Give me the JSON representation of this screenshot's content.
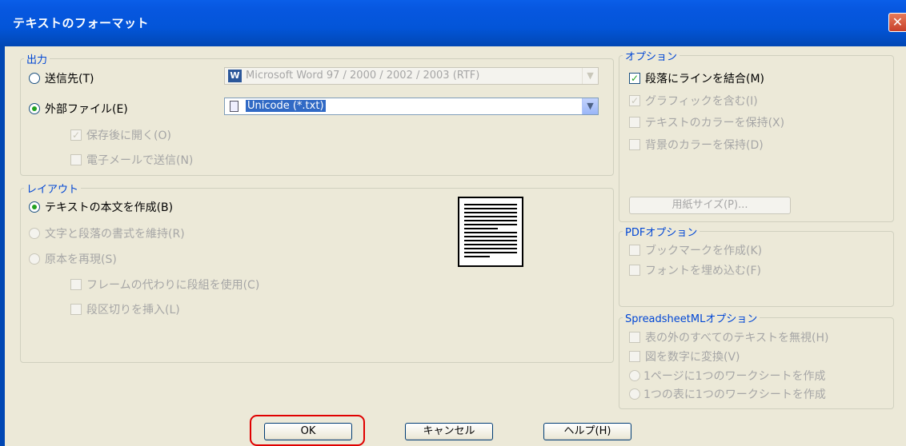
{
  "window": {
    "title": "テキストのフォーマット",
    "close_label": "✕"
  },
  "output": {
    "legend": "出力",
    "send_to_label": "送信先(T)",
    "send_to_value": "Microsoft Word 97 / 2000 / 2002 / 2003 (RTF)",
    "external_file_label": "外部ファイル(E)",
    "external_file_value": "Unicode (*.txt)",
    "open_after_save_label": "保存後に開く(O)",
    "send_mail_label": "電子メールで送信(N)"
  },
  "layout": {
    "legend": "レイアウト",
    "create_body_label": "テキストの本文を作成(B)",
    "keep_format_label": "文字と段落の書式を維持(R)",
    "reproduce_label": "原本を再現(S)",
    "use_columns_label": "フレームの代わりに段組を使用(C)",
    "insert_breaks_label": "段区切りを挿入(L)"
  },
  "options": {
    "legend": "オプション",
    "combine_lines_label": "段落にラインを結合(M)",
    "include_graphics_label": "グラフィックを含む(I)",
    "keep_text_color_label": "テキストのカラーを保持(X)",
    "keep_bg_color_label": "背景のカラーを保持(D)",
    "paper_size_label": "用紙サイズ(P)..."
  },
  "pdf_options": {
    "legend": "PDFオプション",
    "bookmarks_label": "ブックマークを作成(K)",
    "embed_fonts_label": "フォントを埋め込む(F)"
  },
  "spreadsheetml_options": {
    "legend": "SpreadsheetMLオプション",
    "ignore_text_label": "表の外のすべてのテキストを無視(H)",
    "convert_figures_label": "図を数字に変換(V)",
    "one_sheet_per_page_label": "1ページに1つのワークシートを作成",
    "one_sheet_per_table_label": "1つの表に1つのワークシートを作成"
  },
  "buttons": {
    "ok": "OK",
    "cancel": "キャンセル",
    "help": "ヘルプ(H)"
  },
  "colors": {
    "titlebar": "#0355d8",
    "highlight_ring": "#e00000",
    "selected_text_bg": "#316ac5"
  }
}
